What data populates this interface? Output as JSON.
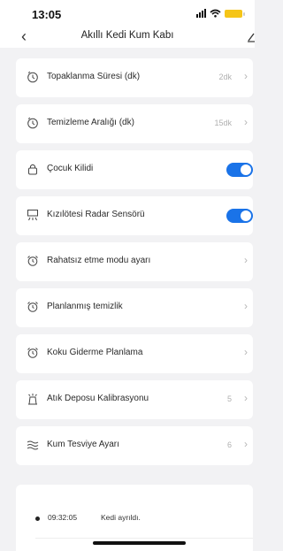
{
  "status_bar": {
    "time": "13:05"
  },
  "nav": {
    "title": "Akıllı Kedi Kum Kabı"
  },
  "items": [
    {
      "label": "Topaklanma Süresi (dk)",
      "value": "2dk",
      "icon": "timer-icon"
    },
    {
      "label": "Temizleme Aralığı (dk)",
      "value": "15dk",
      "icon": "timer-icon"
    },
    {
      "label": "Çocuk Kilidi",
      "toggle": true,
      "icon": "lock-icon"
    },
    {
      "label": "Kızılötesi Radar Sensörü",
      "toggle": true,
      "icon": "radar-sensor-icon"
    },
    {
      "label": "Rahatsız etme modu ayarı",
      "icon": "alarm-clock-icon"
    },
    {
      "label": "Planlanmış temizlik",
      "icon": "alarm-clock-icon"
    },
    {
      "label": "Koku Giderme Planlama",
      "icon": "alarm-clock-icon"
    },
    {
      "label": "Atık Deposu Kalibrasyonu",
      "value": "5",
      "icon": "waste-bin-icon"
    },
    {
      "label": "Kum Tesviye Ayarı",
      "value": "6",
      "icon": "waves-icon"
    }
  ],
  "log": {
    "time": "09:32:05",
    "text": "Kedi ayrıldı."
  },
  "colors": {
    "toggle_on": "#1a73e8",
    "background": "#f2f2f4",
    "battery": "#f5c518"
  }
}
